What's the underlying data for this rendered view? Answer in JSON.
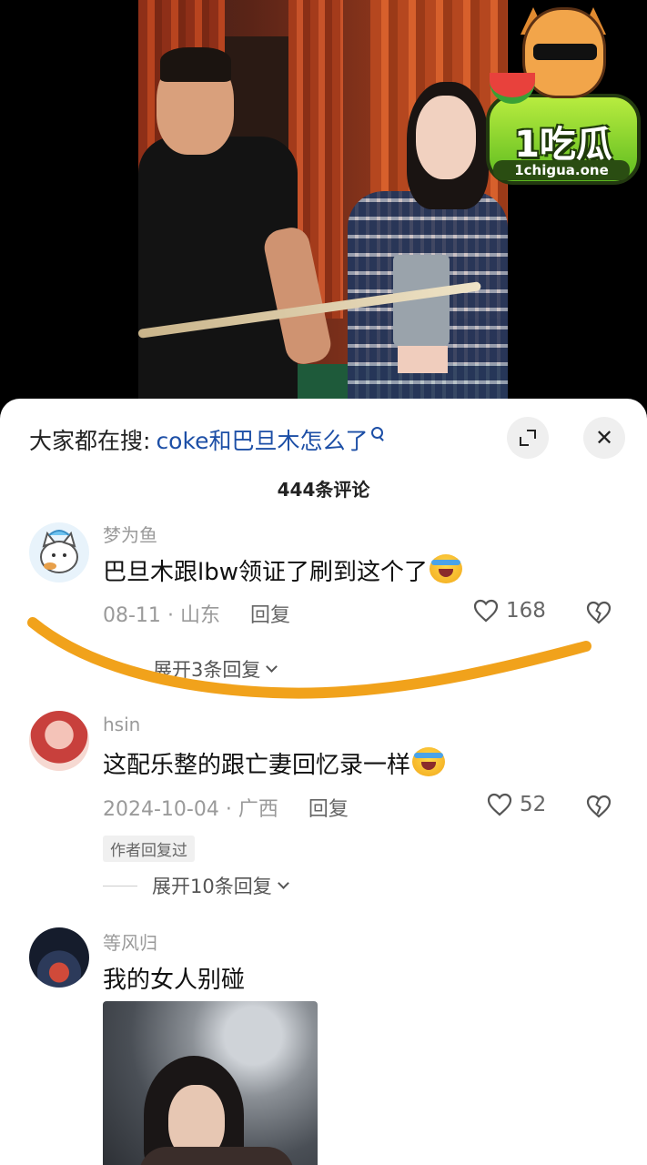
{
  "logo": {
    "main": "1吃瓜",
    "sub": "1chigua.one"
  },
  "panel": {
    "search_label": "大家都在搜:",
    "search_query": "coke和巴旦木怎么了",
    "comment_count": "444条评论"
  },
  "comments": [
    {
      "username": "梦为鱼",
      "text": "巴旦木跟lbw领证了刷到这个了",
      "date": "08-11",
      "location": "山东",
      "reply": "回复",
      "likes": "168",
      "expand": "展开3条回复"
    },
    {
      "username": "hsin",
      "text": "这配乐整的跟亡妻回忆录一样",
      "date": "2024-10-04",
      "location": "广西",
      "reply": "回复",
      "likes": "52",
      "badge": "作者回复过",
      "expand": "展开10条回复"
    },
    {
      "username": "等风归",
      "text": "我的女人别碰"
    }
  ],
  "colors": {
    "link_blue": "#1d4fa6",
    "annotation_orange": "#f1a21b",
    "meta_gray": "#9a9a9a"
  },
  "icons": [
    "search-icon",
    "expand-icon",
    "close-icon",
    "heart-icon",
    "dislike-icon",
    "chevron-down-icon",
    "laugh-cry-emoji"
  ]
}
